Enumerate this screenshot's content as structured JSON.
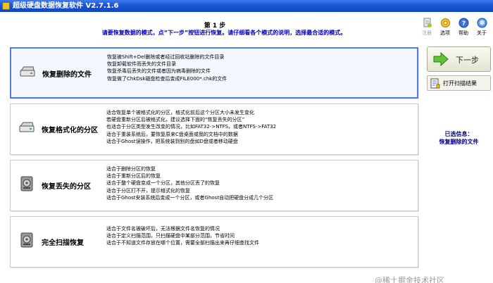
{
  "window": {
    "title": "超级硬盘数据恢复软件 V2.7.1.6"
  },
  "header": {
    "step_title": "第 1 步",
    "step_desc": "请要恢复数据的模式，点“下一步”按钮进行恢复。请仔细看各个模式的说明，选择最合适的模式。"
  },
  "toolbar": {
    "items": [
      {
        "label": "注册",
        "icon": "register-icon",
        "disabled": true
      },
      {
        "label": "选项",
        "icon": "gear-icon",
        "disabled": false
      },
      {
        "label": "帮助",
        "icon": "help-icon",
        "disabled": false
      },
      {
        "label": "关于",
        "icon": "about-icon",
        "disabled": false
      }
    ]
  },
  "options": [
    {
      "title": "恢复删除的文件",
      "icon": "disk-icon",
      "selected": true,
      "lines": [
        "恢复被Shift+Del删除或者经过回收站删除的文件目录",
        "恢复卸载软件而丢失的文件目录",
        "恢复杀毒后丢失的文件或者因为病毒删除的文件",
        "恢复做了ChkDsk磁盘检查后变成FILE000*.chk的文件"
      ]
    },
    {
      "title": "恢复格式化的分区",
      "icon": "disk-icon",
      "selected": false,
      "lines": [
        "适合恢复单个被格式化的分区，格式化前后这个分区大小未发生变化",
        "若硬盘重新分区后被格式化，建议选择下面的“恢复丢失的分区”",
        "也适合于分区类型发生改变的情况，比如FAT32->NTFS，或者NTFS->FAT32",
        "适合于重装系统后，要恢复原来C盘桌面或我的文档中的数据",
        "适合于Ghost误操作，把系统装到别的盘如D盘或者移动硬盘"
      ]
    },
    {
      "title": "恢复丢失的分区",
      "icon": "disk-search-icon",
      "selected": false,
      "lines": [
        "适合于删除分区的恢复",
        "适合于重新分区后的恢复",
        "适合于整个硬盘变成一个分区，其他分区丢了的恢复",
        "适合于分区打不开，提示格式化的恢复",
        "适合于Ghost安装系统后变成一个分区，或者Ghost自动把硬盘分成几个分区"
      ]
    },
    {
      "title": "完全扫描恢复",
      "icon": "disk-search-icon",
      "selected": false,
      "lines": [
        "适合于文件名被破坏后，无法根据文件名恢复的情况",
        "适合于定义扫描范围，只扫描硬盘中某部分范围，节省时间",
        "适合于不知道文件存放在哪个位置，需要全部扫描出来再仔细查找文件"
      ]
    }
  ],
  "sidebar": {
    "next_label": "下一步",
    "open_scan_label": "打开扫描结果",
    "selected_info_label": "已选信息：",
    "selected_info_value": "恢复删除的文件"
  },
  "watermark": "@稀土掘金技术社区",
  "colors": {
    "titlebar": "#1a55d4",
    "accent_blue": "#0000c0",
    "selected_border": "#4e7ddc",
    "next_arrow": "#5fc23a"
  }
}
